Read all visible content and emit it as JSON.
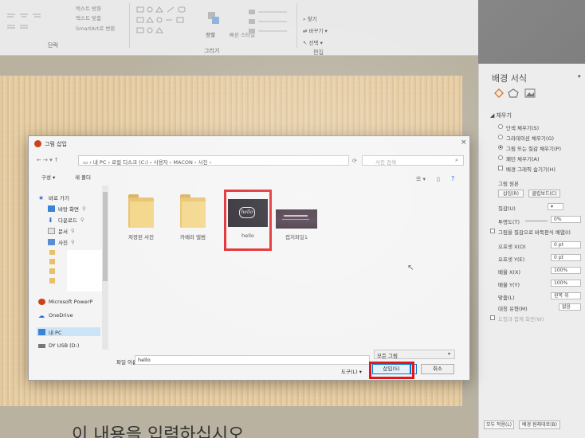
{
  "ribbon": {
    "groups": {
      "paragraph": "단락",
      "drawing": "그리기",
      "editing": "편집"
    },
    "items": {
      "text_direction": "텍스트 방향",
      "align_text": "텍스트 맞춤",
      "smartart": "SmartArt로 변환",
      "arrange": "정렬",
      "quick_styles": "빠른 스타일",
      "find": "찾기",
      "replace": "바꾸기",
      "select": "선택"
    }
  },
  "slide": {
    "body_text": "이 내용을 입력하십시오"
  },
  "format_pane": {
    "title": "배경 서식",
    "section_fill": "채우기",
    "fill_options": [
      "단색 채우기(S)",
      "그라데이션 채우기(G)",
      "그림 또는 질감 채우기(P)",
      "패턴 채우기(A)"
    ],
    "selected_fill_index": 2,
    "hide_bg_graphics": "배경 그래픽 숨기기(H)",
    "picture_source": "그림 원본",
    "insert_btn": "삽입(R)",
    "clipboard_btn": "클립보드(C)",
    "texture_label": "질감(U)",
    "transparency_label": "투명도(T)",
    "transparency_value": "0%",
    "tile_checkbox": "그림을 질감으로 바둑판식 배열(I)",
    "offset_x_label": "오프셋 X(O)",
    "offset_x": "0 pt",
    "offset_y_label": "오프셋 Y(E)",
    "offset_y": "0 pt",
    "scale_x_label": "배율 X(X)",
    "scale_x": "100%",
    "scale_y_label": "배율 Y(Y)",
    "scale_y": "100%",
    "alignment_label": "맞춤(L)",
    "alignment_value": "왼쪽 위",
    "mirror_label": "대칭 유형(M)",
    "mirror_value": "없음",
    "rotate_with_shape": "도형과 함께 회전(W)",
    "apply_all_btn": "모두 적용(L)",
    "reset_bg_btn": "배경 원래대로(B)"
  },
  "dialog": {
    "title": "그림 삽입",
    "breadcrumb": [
      "내 PC",
      "로컬 디스크 (C:)",
      "사용자",
      "MACON",
      "사진"
    ],
    "search_placeholder": "사진 검색",
    "organize": "구성 ▾",
    "new_folder": "새 폴더",
    "nav": [
      {
        "label": "바로 가기",
        "icon": "star-icon"
      },
      {
        "label": "바탕 화면",
        "icon": "desktop-icon"
      },
      {
        "label": "다운로드",
        "icon": "download-icon"
      },
      {
        "label": "문서",
        "icon": "document-icon"
      },
      {
        "label": "사진",
        "icon": "pictures-icon"
      },
      {
        "label": "Microsoft PowerP",
        "icon": "powerpoint-icon"
      },
      {
        "label": "OneDrive",
        "icon": "cloud-icon"
      },
      {
        "label": "내 PC",
        "icon": "computer-icon"
      },
      {
        "label": "DY USB (D:)",
        "icon": "usb-icon"
      }
    ],
    "files": [
      {
        "name": "저장된 사진",
        "type": "folder"
      },
      {
        "name": "카메라 앨범",
        "type": "folder"
      },
      {
        "name": "hello",
        "type": "image"
      },
      {
        "name": "캡처파일1",
        "type": "image"
      }
    ],
    "thumb_text_hello": "hello",
    "filename_label": "파일 이름(N):",
    "filename_value": "hello",
    "filetype_value": "모든 그림",
    "tools": "도구(L)",
    "insert": "삽입(S)",
    "cancel": "취소"
  },
  "colors": {
    "highlight": "#e2161a",
    "accent_blue": "#1e6fd0"
  }
}
